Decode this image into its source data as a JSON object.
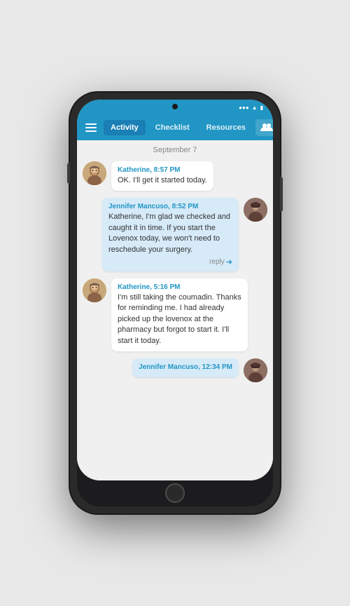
{
  "phone": {
    "nav": {
      "tabs": [
        {
          "id": "activity",
          "label": "Activity",
          "active": true
        },
        {
          "id": "checklist",
          "label": "Checklist",
          "active": false
        },
        {
          "id": "resources",
          "label": "Resources",
          "active": false
        }
      ],
      "group_button_label": "Group"
    },
    "date_separator": "September 7",
    "messages": [
      {
        "id": "msg1",
        "direction": "incoming",
        "sender": "Katherine, 8:57 PM",
        "text": "OK. I'll get it started today.",
        "avatar_type": "katherine",
        "show_reply": false
      },
      {
        "id": "msg2",
        "direction": "outgoing",
        "sender": "Jennifer Mancuso, 8:52 PM",
        "text": "Katherine, I'm glad we checked and caught it in time. If you start the Lovenox today, we won't need to reschedule your surgery.",
        "avatar_type": "jennifer",
        "show_reply": true,
        "reply_label": "reply"
      },
      {
        "id": "msg3",
        "direction": "incoming",
        "sender": "Katherine, 5:16 PM",
        "text": "I'm still taking the coumadin. Thanks for reminding me. I had already picked up the lovenox at the pharmacy but forgot to start it. I'll start it today.",
        "avatar_type": "katherine",
        "show_reply": false
      },
      {
        "id": "msg4",
        "direction": "outgoing",
        "sender": "Jennifer Mancuso, 12:34 PM",
        "text": "",
        "avatar_type": "jennifer",
        "show_reply": false
      }
    ]
  }
}
